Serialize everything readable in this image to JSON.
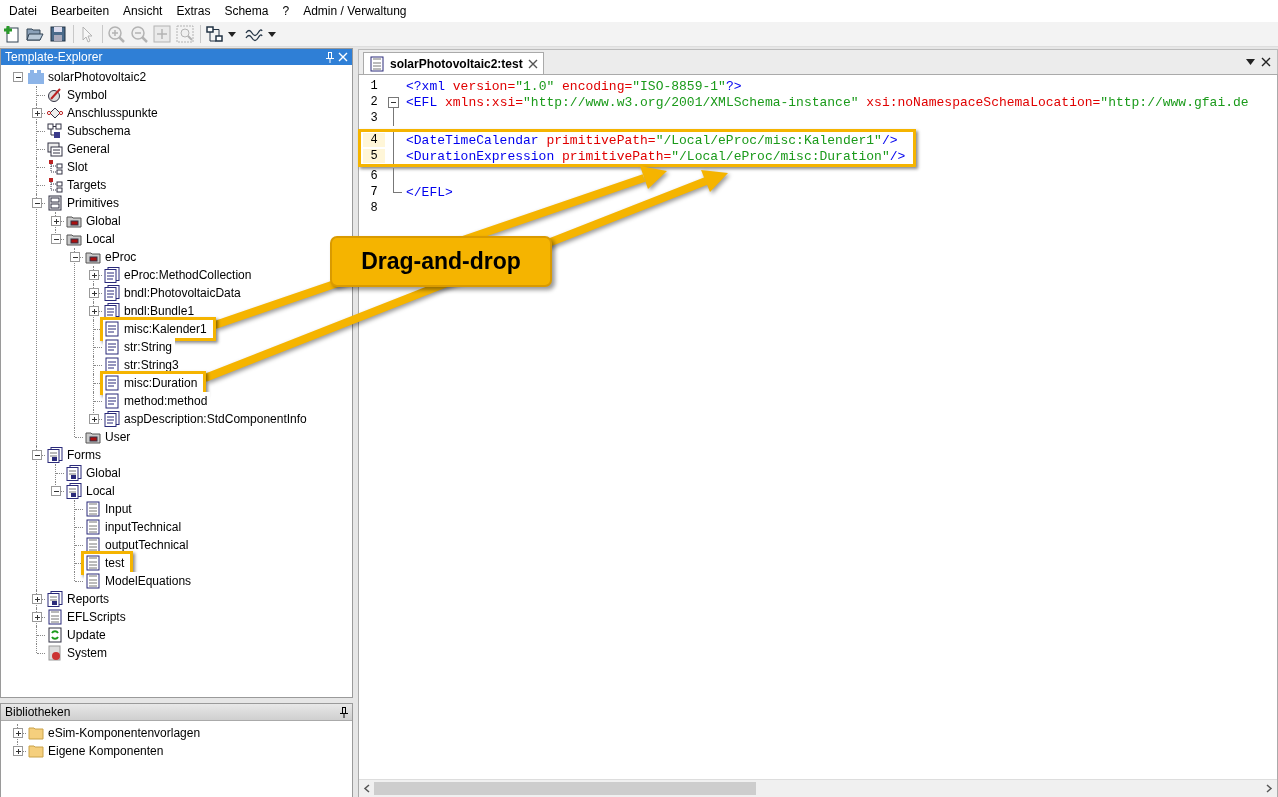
{
  "menu": [
    "Datei",
    "Bearbeiten",
    "Ansicht",
    "Extras",
    "Schema",
    "?",
    "Admin / Verwaltung"
  ],
  "toolbar": [
    [
      {
        "kind": "new",
        "disabled": false,
        "dropdown": false
      },
      {
        "kind": "open",
        "disabled": false,
        "dropdown": false
      },
      {
        "kind": "save",
        "disabled": false,
        "dropdown": false
      }
    ],
    [
      {
        "kind": "pointer",
        "disabled": true,
        "dropdown": false
      }
    ],
    [
      {
        "kind": "zoomin",
        "disabled": true,
        "dropdown": false
      },
      {
        "kind": "zoomout",
        "disabled": true,
        "dropdown": false
      },
      {
        "kind": "fit",
        "disabled": true,
        "dropdown": false
      },
      {
        "kind": "zoomarea",
        "disabled": true,
        "dropdown": false
      }
    ],
    [
      {
        "kind": "layout",
        "disabled": false,
        "dropdown": true
      },
      {
        "kind": "wave",
        "disabled": false,
        "dropdown": true
      }
    ]
  ],
  "explorer": {
    "title": "Template-Explorer",
    "tree": [
      {
        "label": "solarPhotovoltaic2",
        "kind": "component",
        "expanded": true,
        "highlighted": false,
        "children": [
          {
            "label": "Symbol",
            "kind": "symbol",
            "highlighted": false
          },
          {
            "label": "Anschlusspunkte",
            "kind": "connectors",
            "expanded": false,
            "highlighted": false
          },
          {
            "label": "Subschema",
            "kind": "subschema",
            "highlighted": false
          },
          {
            "label": "General",
            "kind": "general",
            "highlighted": false
          },
          {
            "label": "Slot",
            "kind": "slot",
            "highlighted": false
          },
          {
            "label": "Targets",
            "kind": "slot",
            "highlighted": false
          },
          {
            "label": "Primitives",
            "kind": "cabinet",
            "expanded": true,
            "highlighted": false,
            "children": [
              {
                "label": "Global",
                "kind": "package",
                "expanded": false,
                "highlighted": false
              },
              {
                "label": "Local",
                "kind": "package",
                "expanded": true,
                "highlighted": false,
                "children": [
                  {
                    "label": "eProc",
                    "kind": "package",
                    "expanded": true,
                    "highlighted": false,
                    "children": [
                      {
                        "label": "eProc:MethodCollection",
                        "kind": "stack",
                        "expanded": false,
                        "highlighted": false
                      },
                      {
                        "label": "bndl:PhotovoltaicData",
                        "kind": "stack",
                        "expanded": false,
                        "highlighted": false
                      },
                      {
                        "label": "bndl:Bundle1",
                        "kind": "stack",
                        "expanded": false,
                        "highlighted": false
                      },
                      {
                        "label": "misc:Kalender1",
                        "kind": "document",
                        "highlighted": true
                      },
                      {
                        "label": "str:String",
                        "kind": "document",
                        "highlighted": false
                      },
                      {
                        "label": "str:String3",
                        "kind": "document",
                        "highlighted": false
                      },
                      {
                        "label": "misc:Duration",
                        "kind": "document",
                        "highlighted": true
                      },
                      {
                        "label": "method:method",
                        "kind": "document",
                        "highlighted": false
                      },
                      {
                        "label": "aspDescription:StdComponentInfo",
                        "kind": "stack",
                        "expanded": false,
                        "highlighted": false
                      }
                    ]
                  },
                  {
                    "label": "User",
                    "kind": "package",
                    "highlighted": false
                  }
                ]
              }
            ]
          },
          {
            "label": "Forms",
            "kind": "formstack",
            "expanded": true,
            "highlighted": false,
            "children": [
              {
                "label": "Global",
                "kind": "formstack",
                "highlighted": false
              },
              {
                "label": "Local",
                "kind": "formstack",
                "expanded": true,
                "highlighted": false,
                "children": [
                  {
                    "label": "Input",
                    "kind": "form",
                    "highlighted": false
                  },
                  {
                    "label": "inputTechnical",
                    "kind": "form",
                    "highlighted": false
                  },
                  {
                    "label": "outputTechnical",
                    "kind": "form",
                    "highlighted": false
                  },
                  {
                    "label": "test",
                    "kind": "form",
                    "highlighted": true
                  },
                  {
                    "label": "ModelEquations",
                    "kind": "form",
                    "highlighted": false
                  }
                ]
              }
            ]
          },
          {
            "label": "Reports",
            "kind": "formstack",
            "expanded": false,
            "highlighted": false
          },
          {
            "label": "EFLScripts",
            "kind": "form",
            "expanded": false,
            "highlighted": false
          },
          {
            "label": "Update",
            "kind": "update",
            "highlighted": false
          },
          {
            "label": "System",
            "kind": "system",
            "highlighted": false
          }
        ]
      }
    ]
  },
  "libraries": {
    "title": "Bibliotheken",
    "tree": [
      {
        "label": "eSim-Komponentenvorlagen",
        "kind": "folder",
        "expanded": false,
        "highlighted": false
      },
      {
        "label": "Eigene Komponenten",
        "kind": "folder",
        "expanded": false,
        "highlighted": false
      }
    ]
  },
  "editor": {
    "tab": {
      "label": "solarPhotovoltaic2:test",
      "selected": true
    },
    "lines": [
      {
        "number": "1",
        "kind": "plain",
        "highlighted": false,
        "segments": [
          {
            "kind": "tag",
            "text": "<?xml"
          },
          {
            "kind": "attr",
            "text": " version="
          },
          {
            "kind": "value",
            "text": "\"1.0\""
          },
          {
            "kind": "attr",
            "text": " encoding="
          },
          {
            "kind": "value",
            "text": "\"ISO-8859-1\""
          },
          {
            "kind": "tag",
            "text": "?>"
          }
        ]
      },
      {
        "number": "2",
        "kind": "opener",
        "highlighted": false,
        "segments": [
          {
            "kind": "tag",
            "text": "<EFL"
          },
          {
            "kind": "attr",
            "text": " xmlns:xsi="
          },
          {
            "kind": "value",
            "text": "\"http://www.w3.org/2001/XMLSchema-instance\""
          },
          {
            "kind": "attr",
            "text": " xsi:noNamespaceSchemaLocation="
          },
          {
            "kind": "value",
            "text": "\"http://www.gfai.de"
          }
        ]
      },
      {
        "number": "3",
        "kind": "inner",
        "highlighted": false
      },
      {
        "number": "4",
        "kind": "inner",
        "highlighted": true,
        "segments": [
          {
            "kind": "tag",
            "text": "<DateTimeCalendar"
          },
          {
            "kind": "attr",
            "text": " primitivePath="
          },
          {
            "kind": "value",
            "text": "\"/Local/eProc/misc:Kalender1\""
          },
          {
            "kind": "tag",
            "text": "/>"
          }
        ]
      },
      {
        "number": "5",
        "kind": "inner",
        "highlighted": true,
        "segments": [
          {
            "kind": "tag",
            "text": "<DurationExpression"
          },
          {
            "kind": "attr",
            "text": " primitivePath="
          },
          {
            "kind": "value",
            "text": "\"/Local/eProc/misc:Duration\""
          },
          {
            "kind": "tag",
            "text": "/>"
          }
        ]
      },
      {
        "number": "6",
        "kind": "inner",
        "highlighted": false
      },
      {
        "number": "7",
        "kind": "closer",
        "highlighted": false,
        "segments": [
          {
            "kind": "tag",
            "text": "</EFL>"
          }
        ]
      },
      {
        "number": "8",
        "kind": "plain",
        "highlighted": false
      }
    ]
  },
  "callout": {
    "text": "Drag-and-drop"
  }
}
